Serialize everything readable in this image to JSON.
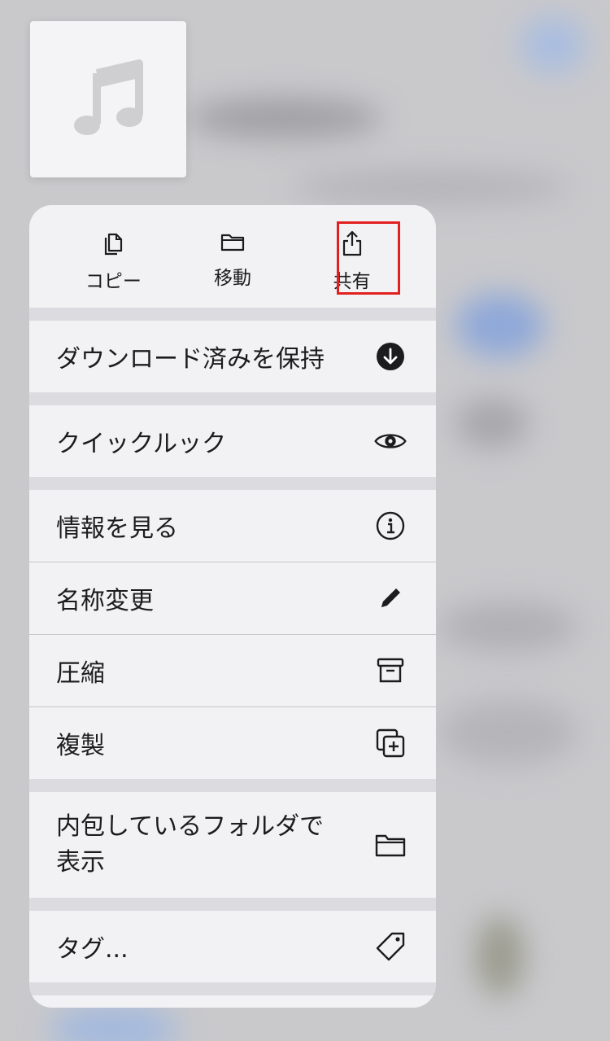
{
  "top_actions": [
    {
      "label": "コピー",
      "icon": "copy-icon"
    },
    {
      "label": "移動",
      "icon": "folder-icon"
    },
    {
      "label": "共有",
      "icon": "share-icon"
    }
  ],
  "menu": {
    "keep_downloaded": {
      "label": "ダウンロード済みを保持",
      "icon": "download-circle-icon"
    },
    "quick_look": {
      "label": "クイックルック",
      "icon": "eye-icon"
    },
    "get_info": {
      "label": "情報を見る",
      "icon": "info-icon"
    },
    "rename": {
      "label": "名称変更",
      "icon": "pencil-icon"
    },
    "compress": {
      "label": "圧縮",
      "icon": "archive-icon"
    },
    "duplicate": {
      "label": "複製",
      "icon": "duplicate-icon"
    },
    "show_in_folder": {
      "label": "内包しているフォルダで表示",
      "icon": "folder-icon"
    },
    "tags": {
      "label": "タグ...",
      "icon": "tag-icon"
    }
  },
  "colors": {
    "highlight": "#e22020",
    "menu_bg": "#f2f2f4"
  }
}
